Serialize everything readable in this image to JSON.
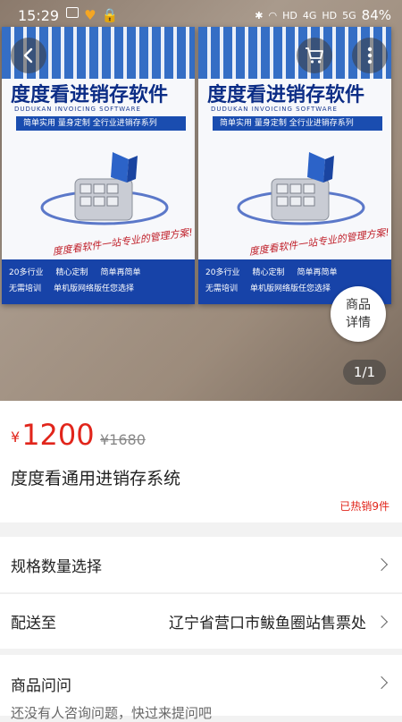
{
  "status_bar": {
    "time": "15:29",
    "network_labels": [
      "HD",
      "4G",
      "HD",
      "5G"
    ],
    "battery": "84%"
  },
  "hero": {
    "box_text": {
      "title": "度度看进销存软件",
      "subtitle": "DUDUKAN INVOICING SOFTWARE",
      "slogan": "简单实用  量身定制  全行业进销存系列",
      "tagline": "度度看软件一站专业的管理方案!",
      "features_row1": [
        "20多行业",
        "精心定制",
        "简单再简单"
      ],
      "features_row2": [
        "无需培训",
        "单机版网络版任您选择"
      ]
    },
    "detail_badge": [
      "商品",
      "详情"
    ],
    "pager": "1/1"
  },
  "product": {
    "currency": "¥",
    "price": "1200",
    "original_price": "¥1680",
    "title": "度度看通用进销存系统",
    "sold": "已热销9件"
  },
  "rows": {
    "spec_label": "规格数量选择",
    "ship_label": "配送至",
    "ship_value": "辽宁省营口市鲅鱼圈站售票处",
    "qa_label": "商品问问",
    "qa_hint": "还没有人咨询问题，快过来提问吧"
  },
  "colors": {
    "accent": "#e1251b",
    "box_blue": "#1743a8"
  }
}
